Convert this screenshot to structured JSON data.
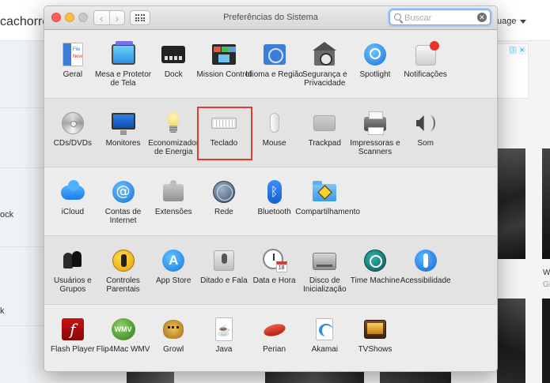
{
  "background": {
    "left_title": "cachorro",
    "right_text": "uage",
    "left_labels": [
      "ock",
      "k"
    ],
    "caption": "W",
    "caption2": "Gi"
  },
  "window": {
    "title": "Preferências do Sistema",
    "search": {
      "placeholder": "Buscar",
      "value": ""
    },
    "rows": [
      [
        {
          "label": "Geral",
          "icon": "general-icon"
        },
        {
          "label": "Mesa e Protetor de Tela",
          "icon": "desktop-screensaver-icon"
        },
        {
          "label": "Dock",
          "icon": "dock-icon"
        },
        {
          "label": "Mission Control",
          "icon": "mission-control-icon"
        },
        {
          "label": "Idioma e Região",
          "icon": "language-region-icon"
        },
        {
          "label": "Segurança e Privacidade",
          "icon": "security-privacy-icon"
        },
        {
          "label": "Spotlight",
          "icon": "spotlight-icon"
        },
        {
          "label": "Notificações",
          "icon": "notifications-icon"
        }
      ],
      [
        {
          "label": "CDs/DVDs",
          "icon": "cd-dvd-icon"
        },
        {
          "label": "Monitores",
          "icon": "displays-icon"
        },
        {
          "label": "Economizador de Energia",
          "icon": "energy-saver-icon"
        },
        {
          "label": "Teclado",
          "icon": "keyboard-icon",
          "highlighted": true
        },
        {
          "label": "Mouse",
          "icon": "mouse-icon"
        },
        {
          "label": "Trackpad",
          "icon": "trackpad-icon"
        },
        {
          "label": "Impressoras e Scanners",
          "icon": "printers-scanners-icon"
        },
        {
          "label": "Som",
          "icon": "sound-icon"
        }
      ],
      [
        {
          "label": "iCloud",
          "icon": "icloud-icon"
        },
        {
          "label": "Contas de Internet",
          "icon": "internet-accounts-icon"
        },
        {
          "label": "Extensões",
          "icon": "extensions-icon"
        },
        {
          "label": "Rede",
          "icon": "network-icon"
        },
        {
          "label": "Bluetooth",
          "icon": "bluetooth-icon"
        },
        {
          "label": "Compartilhamento",
          "icon": "sharing-icon"
        }
      ],
      [
        {
          "label": "Usuários e Grupos",
          "icon": "users-groups-icon"
        },
        {
          "label": "Controles Parentais",
          "icon": "parental-controls-icon"
        },
        {
          "label": "App Store",
          "icon": "app-store-icon"
        },
        {
          "label": "Ditado e Fala",
          "icon": "dictation-speech-icon"
        },
        {
          "label": "Data e Hora",
          "icon": "date-time-icon"
        },
        {
          "label": "Disco de Inicialização",
          "icon": "startup-disk-icon"
        },
        {
          "label": "Time Machine",
          "icon": "time-machine-icon"
        },
        {
          "label": "Acessibilidade",
          "icon": "accessibility-icon"
        }
      ],
      [
        {
          "label": "Flash Player",
          "icon": "flash-player-icon"
        },
        {
          "label": "Flip4Mac WMV",
          "icon": "flip4mac-icon"
        },
        {
          "label": "Growl",
          "icon": "growl-icon"
        },
        {
          "label": "Java",
          "icon": "java-icon"
        },
        {
          "label": "Perian",
          "icon": "perian-icon"
        },
        {
          "label": "Akamai",
          "icon": "akamai-icon"
        },
        {
          "label": "TVShows",
          "icon": "tvshows-icon"
        }
      ]
    ],
    "icon_glyphs": {
      "doc_file": "File",
      "doc_new": "New",
      "at": "@",
      "bluetooth": "ᛒ",
      "appstore": "A",
      "flash": "f",
      "wmv": "WMV",
      "java": "☕",
      "calendar_day": "18"
    }
  },
  "colors": {
    "highlight_border": "#e03c31",
    "search_focus": "#7aa7e6"
  }
}
